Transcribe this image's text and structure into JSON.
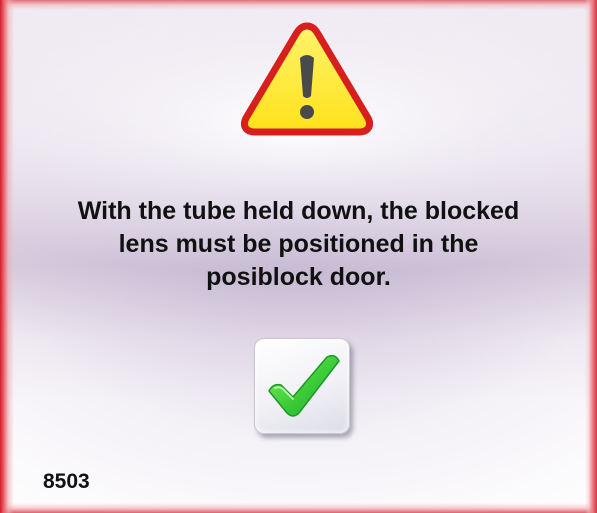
{
  "dialog": {
    "type": "warning",
    "icon": "warning-triangle-icon",
    "message": "With the tube held down, the blocked\nlens must be positioned in the\nposiblock door.",
    "confirm_icon": "checkmark-icon",
    "code": "8503"
  },
  "colors": {
    "warning_fill": "#ffea3a",
    "warning_border": "#d91e1e",
    "check_green": "#37c837",
    "edge_red": "#d41c2a",
    "text": "#111111"
  }
}
